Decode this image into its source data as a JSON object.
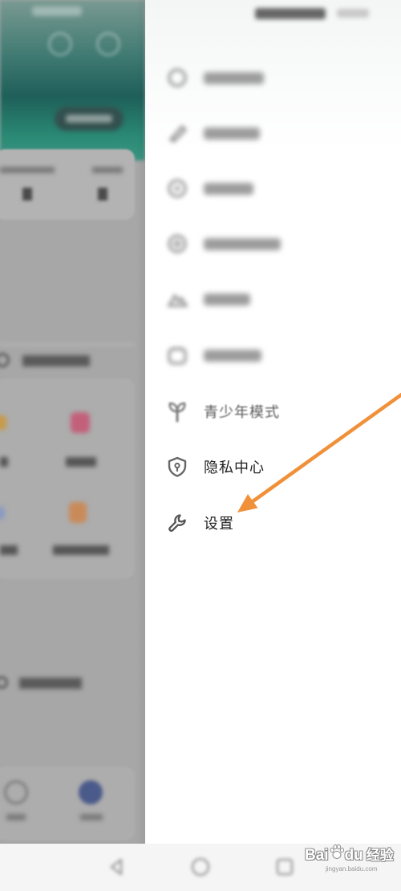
{
  "drawer": {
    "items": [
      {
        "icon": "blurred-icon"
      },
      {
        "icon": "blurred-icon"
      },
      {
        "icon": "blurred-icon"
      },
      {
        "icon": "blurred-icon"
      },
      {
        "icon": "blurred-icon"
      },
      {
        "icon": "blurred-icon"
      },
      {
        "icon": "sapling-icon",
        "label": "青少年模式"
      },
      {
        "icon": "shield-lock-icon",
        "label": "隐私中心"
      },
      {
        "icon": "wrench-icon",
        "label": "设置"
      }
    ]
  },
  "watermark": {
    "brand_left": "Bai",
    "brand_right": "du",
    "suffix": "经验",
    "url": "jingyan.baidu.com"
  },
  "colors": {
    "annotation_arrow": "#f0913a",
    "drawer_background": "#ffffff",
    "app_header_green": "#2a8a74",
    "dim_overlay": "#a7a7a7"
  }
}
